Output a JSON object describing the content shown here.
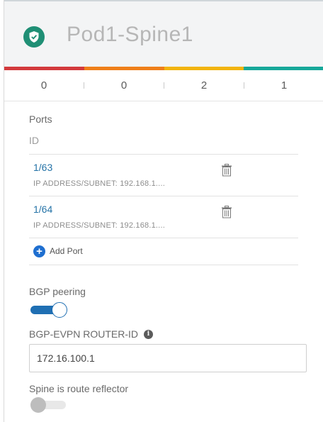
{
  "header": {
    "title": "Pod1-Spine1",
    "badge_icon": "shield-check-icon",
    "badge_color": "#1f8f75"
  },
  "health_bar": {
    "colors": [
      "#d33a3d",
      "#ef7f1a",
      "#f2b40f",
      "#17a89a"
    ]
  },
  "counts": [
    "0",
    "0",
    "2",
    "1"
  ],
  "ports": {
    "section_label": "Ports",
    "column_label": "ID",
    "rows": [
      {
        "id": "1/63",
        "ip": "IP ADDRESS/SUBNET: 192.168.1...."
      },
      {
        "id": "1/64",
        "ip": "IP ADDRESS/SUBNET: 192.168.1...."
      }
    ],
    "add_label": "Add Port"
  },
  "bgp_peering": {
    "label": "BGP peering",
    "enabled": true
  },
  "router_id": {
    "label": "BGP-EVPN ROUTER-ID",
    "value": "172.16.100.1"
  },
  "route_reflector": {
    "label": "Spine is route reflector",
    "enabled": false
  }
}
